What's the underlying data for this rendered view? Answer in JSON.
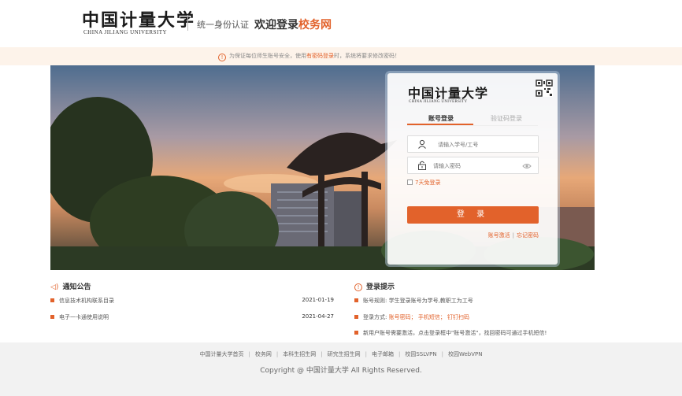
{
  "header": {
    "logo_cn": "中国计量大学",
    "logo_en": "CHINA JILIANG UNIVERSITY",
    "subtitle": "统一身份认证",
    "welcome_prefix": "欢迎登录",
    "welcome_accent": "校务网"
  },
  "notice": {
    "icon": "!",
    "text_before": "为保证每位师生账号安全，使用",
    "highlight": "有密码登录",
    "text_after": "时，系统将要求修改密码！"
  },
  "login": {
    "logo_cn": "中国计量大学",
    "logo_en": "CHINA JILIANG UNIVERSITY",
    "tabs": [
      {
        "label": "账号登录"
      },
      {
        "label": "验证码登录"
      }
    ],
    "username_placeholder": "请输入学号/工号",
    "password_placeholder": "请输入密码",
    "remember_label": "7天免登录",
    "login_button": "登 录",
    "activate_link": "账号激活",
    "forgot_link": "忘记密码",
    "link_sep": "|"
  },
  "announcements": {
    "title": "通知公告",
    "icon": "◁)",
    "items": [
      {
        "text": "信息技术机构联系目录",
        "date": "2021-01-19"
      },
      {
        "text": "电子一卡通使用说明",
        "date": "2021-04-27"
      }
    ]
  },
  "tips": {
    "title": "登录提示",
    "icon": "!",
    "items": [
      {
        "before": "账号规则: 学生登录账号为学号,教职工为工号",
        "hl": "",
        "after": ""
      },
      {
        "before": "登录方式: ",
        "hl": "账号密码；  手机短信；  钉钉扫码",
        "after": ""
      },
      {
        "before": "新用户账号需要激活，点击登录框中\"账号激活\"，找回密码可通过手机短信!",
        "hl": "",
        "after": ""
      }
    ]
  },
  "footer": {
    "links": [
      "中国计量大学首页",
      "校务网",
      "本科生招生网",
      "研究生招生网",
      "电子邮箱",
      "校园SSLVPN",
      "校园WebVPN"
    ],
    "copyright": "Copyright @ 中国计量大学 All Rights Reserved."
  },
  "colors": {
    "accent": "#e2622b",
    "notice_bg": "#fdf3ea",
    "footer_bg": "#f2f2f2"
  }
}
